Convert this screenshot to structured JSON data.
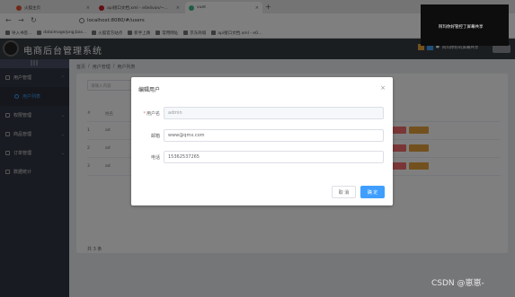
{
  "browser": {
    "tabs": [
      {
        "title": "火狐主页",
        "icon": "firefox-icon",
        "color": "#e0522f"
      },
      {
        "title": "api接口文档.xml - e0elivan/~...",
        "icon": "gitee-icon",
        "color": "#c71d23"
      },
      {
        "title": "vuet",
        "icon": "vue-icon",
        "color": "#42b883"
      }
    ],
    "new_tab": "+",
    "url": "localhost:8080/#/users",
    "bookmarks": [
      "导入书签...",
      "dataimage/png;bas...",
      "火狐官方站点",
      "新手上路",
      "常用网址",
      "京东商城",
      "api接口文档.xml - e0..."
    ]
  },
  "notification": {
    "message": "阿玛你好管控了屏幕共享"
  },
  "app": {
    "title": "电商后台管理系统",
    "share_text": "阿玛你好的屏幕共享",
    "sidebar_toggle": "|||",
    "menu": [
      {
        "label": "用户管理",
        "icon": "user-icon",
        "expanded": true
      },
      {
        "label": "用户列表",
        "icon": "list-icon",
        "sub": true
      },
      {
        "label": "权限管理",
        "icon": "lock-icon"
      },
      {
        "label": "商品管理",
        "icon": "goods-icon"
      },
      {
        "label": "订单管理",
        "icon": "order-icon"
      },
      {
        "label": "数据统计",
        "icon": "chart-icon"
      }
    ]
  },
  "breadcrumb": [
    "首页",
    "/",
    "用户管理",
    "/",
    "用户列表"
  ],
  "search_placeholder": "请输入内容",
  "table": {
    "headers": [
      "#",
      "姓名",
      "",
      "",
      "",
      "",
      "",
      "操作"
    ],
    "rows": [
      {
        "index": "1",
        "name": "ad"
      },
      {
        "index": "2",
        "name": "ad"
      },
      {
        "index": "3",
        "name": "ad"
      }
    ]
  },
  "pager_text": "共 3 条",
  "dialog": {
    "title": "编辑用户",
    "close": "×",
    "fields": [
      {
        "label": "用户名",
        "required": true,
        "value": "admin",
        "disabled": true
      },
      {
        "label": "邮箱",
        "required": false,
        "value": "www@qmx.com",
        "disabled": false
      },
      {
        "label": "电话",
        "required": false,
        "value": "15362537265",
        "disabled": false
      }
    ],
    "cancel": "取 消",
    "confirm": "确 定"
  },
  "watermark": "CSDN @崽崽-",
  "colors": {
    "primary": "#409eff",
    "danger": "#f56c6c",
    "warning": "#e6a23c",
    "header": "#373d41",
    "sidebar": "#333744"
  }
}
